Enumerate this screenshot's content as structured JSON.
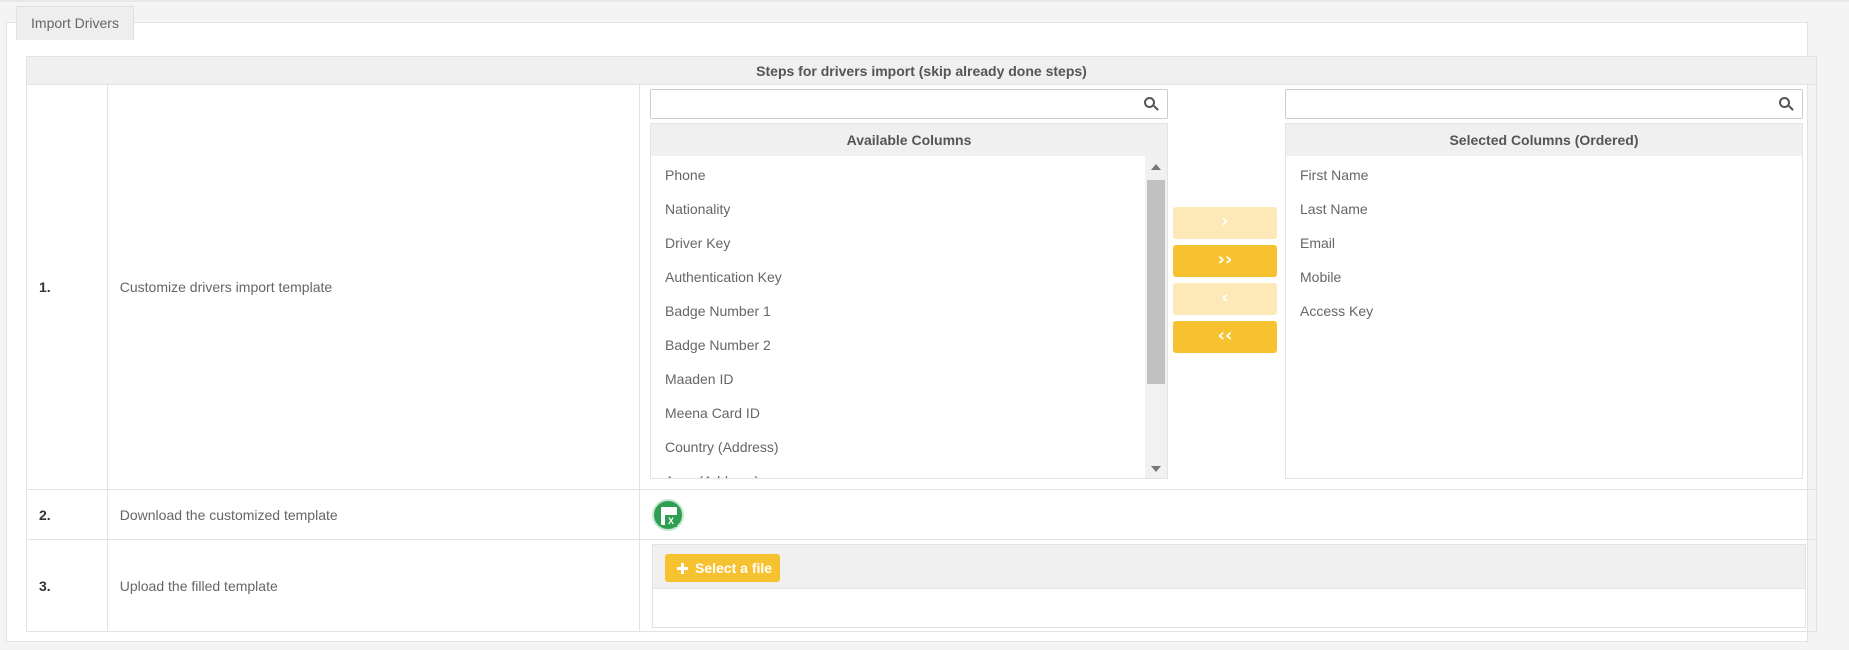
{
  "tab": {
    "title": "Import Drivers"
  },
  "table": {
    "header": "Steps for drivers import (skip already done steps)",
    "steps": [
      {
        "num": "1.",
        "label": "Customize drivers import template"
      },
      {
        "num": "2.",
        "label": "Download the customized template"
      },
      {
        "num": "3.",
        "label": "Upload the filled template"
      }
    ]
  },
  "available": {
    "title": "Available Columns",
    "search_value": "",
    "items": [
      "Phone",
      "Nationality",
      "Driver Key",
      "Authentication Key",
      "Badge Number 1",
      "Badge Number 2",
      "Maaden ID",
      "Meena Card ID",
      "Country (Address)",
      "Area (Address)"
    ]
  },
  "selected": {
    "title": "Selected Columns (Ordered)",
    "search_value": "",
    "items": [
      "First Name",
      "Last Name",
      "Email",
      "Mobile",
      "Access Key"
    ]
  },
  "move_buttons": {
    "move_right": "›",
    "move_all_right": "››",
    "move_left": "‹",
    "move_all_left": "‹‹"
  },
  "download": {
    "icon": "excel-icon",
    "icon_letter": "X"
  },
  "upload": {
    "button_label": "Select a file",
    "button_icon": "plus-icon"
  },
  "colors": {
    "accent": "#f7c230",
    "accent_light": "#fde9b8",
    "excel": "#2e9e52"
  }
}
